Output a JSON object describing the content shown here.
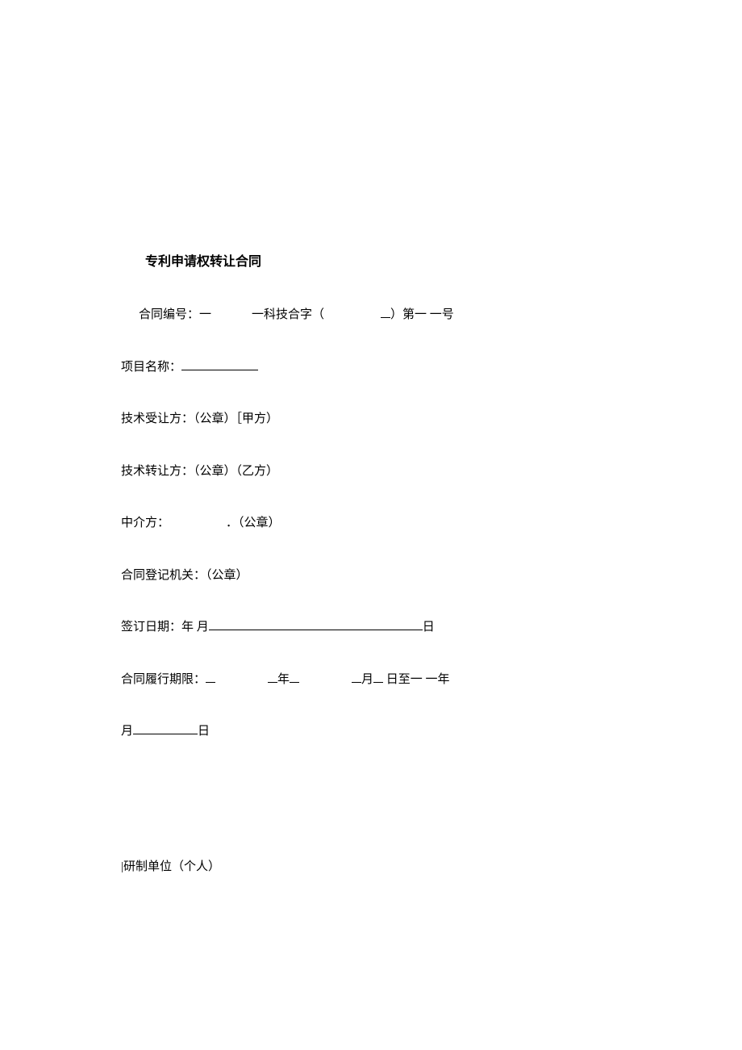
{
  "title": "专利申请权转让合同",
  "lines": {
    "contract_no_prefix": "合同编号：一",
    "contract_no_mid": "一科技合字（",
    "contract_no_suffix": "）第一 一号",
    "project_name": "项目名称：",
    "assignee": "技术受让方：（公章）［甲方）",
    "assignor": "技术转让方：（公章）（乙方）",
    "intermediary_prefix": "中介方：",
    "intermediary_suffix": "．（公章）",
    "registration": "合同登记机关：（公章）",
    "sign_date_prefix": "签订日期：年 月",
    "sign_date_suffix": "日",
    "term_prefix": "合同履行期限：",
    "term_year": "年",
    "term_month": "月",
    "term_suffix": " 日至一 一年",
    "month_char": "月",
    "day_char": "日",
    "footer": "|研制单位（个人）"
  }
}
